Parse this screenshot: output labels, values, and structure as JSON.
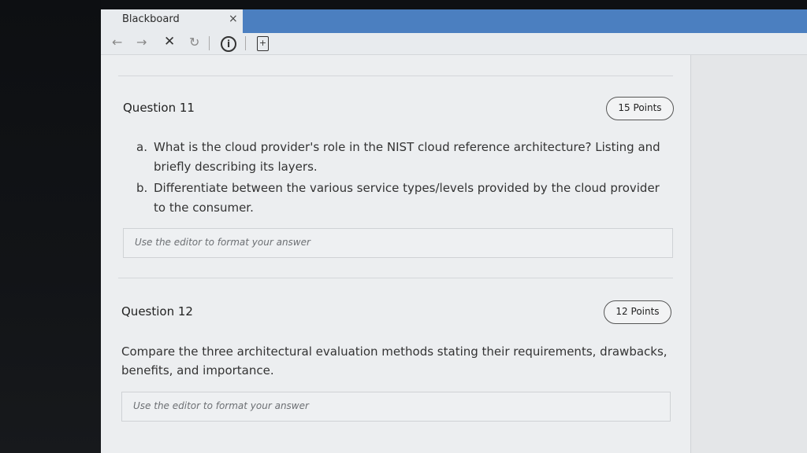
{
  "browser": {
    "tab_title": "Blackboard",
    "tab_close": "×",
    "nav": {
      "back": "←",
      "forward": "→",
      "stop": "✕",
      "reload": "↻",
      "info": "i",
      "page_icon": "+"
    }
  },
  "questions": [
    {
      "title": "Question 11",
      "points": "15 Points",
      "items": [
        {
          "marker": "a.",
          "text": "What is the cloud provider's role in the NIST cloud reference architecture? Listing and briefly describing its layers."
        },
        {
          "marker": "b.",
          "text": "Differentiate between the various service types/levels provided by the cloud provider to the consumer."
        }
      ],
      "answer_placeholder": "Use the editor to format your answer"
    },
    {
      "title": "Question 12",
      "points": "12 Points",
      "text": "Compare the three architectural evaluation methods stating their requirements, drawbacks, benefits, and importance.",
      "answer_placeholder": "Use the editor to format your answer"
    }
  ]
}
